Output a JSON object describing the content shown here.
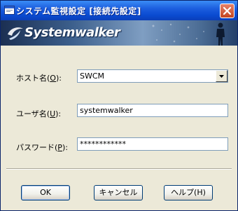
{
  "window": {
    "title": "システム監視設定 [接続先設定]",
    "close_label": "×"
  },
  "banner": {
    "logo_text": "Systemwalker"
  },
  "form": {
    "host": {
      "label_prefix": "ホスト名(",
      "label_accel": "O",
      "label_suffix": "):",
      "value": "SWCM"
    },
    "user": {
      "label_prefix": "ユーザ名(",
      "label_accel": "U",
      "label_suffix": "):",
      "value": "systemwalker"
    },
    "password": {
      "label_prefix": "パスワード(",
      "label_accel": "P",
      "label_suffix": "):",
      "value": "************"
    }
  },
  "buttons": {
    "ok": "OK",
    "cancel": "キャンセル",
    "help": "ヘルプ(H)"
  },
  "colors": {
    "titlebar": "#0a4ad0",
    "dialog_bg": "#ece9d8",
    "close_button": "#c4451f"
  },
  "icons": {
    "app": "app-window-icon",
    "close": "close-icon",
    "dropdown": "chevron-down-icon",
    "figure": "person-silhouette-icon"
  }
}
